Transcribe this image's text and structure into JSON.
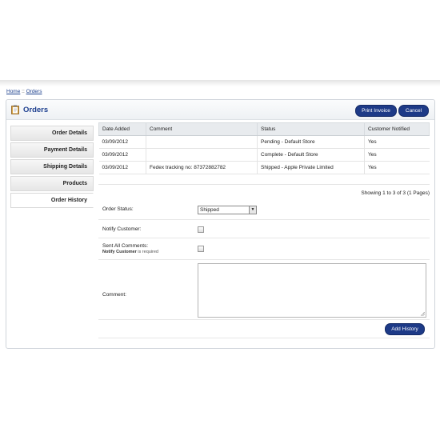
{
  "breadcrumb": {
    "home": "Home",
    "separator": "::",
    "current": "Orders"
  },
  "header": {
    "title": "Orders",
    "print_invoice_label": "Print Invoice",
    "cancel_label": "Cancel"
  },
  "tabs": [
    {
      "label": "Order Details"
    },
    {
      "label": "Payment Details"
    },
    {
      "label": "Shipping Details"
    },
    {
      "label": "Products"
    },
    {
      "label": "Order History"
    }
  ],
  "history": {
    "columns": [
      "Date Added",
      "Comment",
      "Status",
      "Customer Notified"
    ],
    "rows": [
      [
        "03/09/2012",
        "",
        "Pending - Default Store",
        "Yes"
      ],
      [
        "03/09/2012",
        "",
        "Complete - Default Store",
        "Yes"
      ],
      [
        "03/09/2012",
        "Fedex tracking no: 87372882782",
        "Shipped - Apple Private Limited",
        "Yes"
      ]
    ],
    "pagination": "Showing 1 to 3 of 3 (1 Pages)"
  },
  "form": {
    "order_status_label": "Order Status:",
    "order_status_value": "Shipped",
    "notify_customer_label": "Notify Customer:",
    "send_all_label": "Sent All Comments:",
    "send_all_note_bold": "Notify Customer",
    "send_all_note_rest": " is required",
    "comment_label": "Comment:",
    "comment_value": "",
    "add_history_label": "Add History"
  },
  "colors": {
    "accent": "#1d3a87",
    "title": "#1d3f8f"
  },
  "icons": {
    "header": "clipboard-icon",
    "select": "dropdown-arrow-icon"
  }
}
